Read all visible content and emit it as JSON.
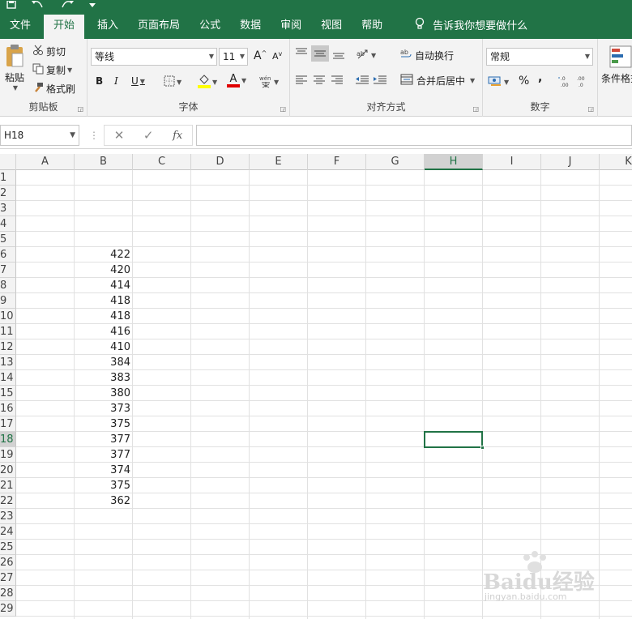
{
  "colors": {
    "accent": "#217346",
    "ribbon_bg": "#f3f3f3",
    "grid_line": "#e1e1e1"
  },
  "quick_access": {
    "icons": [
      "save-icon",
      "undo-icon",
      "redo-icon",
      "customize-icon"
    ]
  },
  "tabs": [
    "文件",
    "开始",
    "插入",
    "页面布局",
    "公式",
    "数据",
    "审阅",
    "视图",
    "帮助"
  ],
  "tell_me": "告诉我你想要做什么",
  "ribbon": {
    "clipboard": {
      "paste": "粘贴",
      "cut": "剪切",
      "copy": "复制",
      "format_painter": "格式刷",
      "label": "剪贴板"
    },
    "font": {
      "name": "等线",
      "size": "11",
      "grow": "A",
      "shrink": "A",
      "bold": "B",
      "italic": "I",
      "underline": "U",
      "font_color": "A",
      "label": "字体"
    },
    "alignment": {
      "wrap": "自动换行",
      "merge": "合并后居中",
      "label": "对齐方式"
    },
    "number": {
      "format": "常规",
      "percent": "%",
      "comma": ",",
      "label": "数字"
    },
    "styles": {
      "conditional": "条件格式"
    }
  },
  "formula_bar": {
    "name_box": "H18",
    "fx": "fx",
    "value": ""
  },
  "columns": [
    "A",
    "B",
    "C",
    "D",
    "E",
    "F",
    "G",
    "H",
    "I",
    "J",
    "K"
  ],
  "selected_column": "H",
  "rows": [
    "1",
    "2",
    "3",
    "4",
    "5",
    "6",
    "7",
    "8",
    "9",
    "10",
    "11",
    "12",
    "13",
    "14",
    "15",
    "16",
    "17",
    "18",
    "19",
    "20",
    "21",
    "22",
    "23",
    "24",
    "25",
    "26",
    "27",
    "28",
    "29"
  ],
  "selected_row": "18",
  "column_b_values": [
    {
      "row": "6",
      "value": "422"
    },
    {
      "row": "7",
      "value": "420"
    },
    {
      "row": "8",
      "value": "414"
    },
    {
      "row": "9",
      "value": "418"
    },
    {
      "row": "10",
      "value": "418"
    },
    {
      "row": "11",
      "value": "416"
    },
    {
      "row": "12",
      "value": "410"
    },
    {
      "row": "13",
      "value": "384"
    },
    {
      "row": "14",
      "value": "383"
    },
    {
      "row": "15",
      "value": "380"
    },
    {
      "row": "16",
      "value": "373"
    },
    {
      "row": "17",
      "value": "375"
    },
    {
      "row": "18",
      "value": "377"
    },
    {
      "row": "19",
      "value": "377"
    },
    {
      "row": "20",
      "value": "374"
    },
    {
      "row": "21",
      "value": "375"
    },
    {
      "row": "22",
      "value": "362"
    }
  ],
  "watermark": {
    "logo": "Baidu经验",
    "url": "jingyan.baidu.com"
  }
}
